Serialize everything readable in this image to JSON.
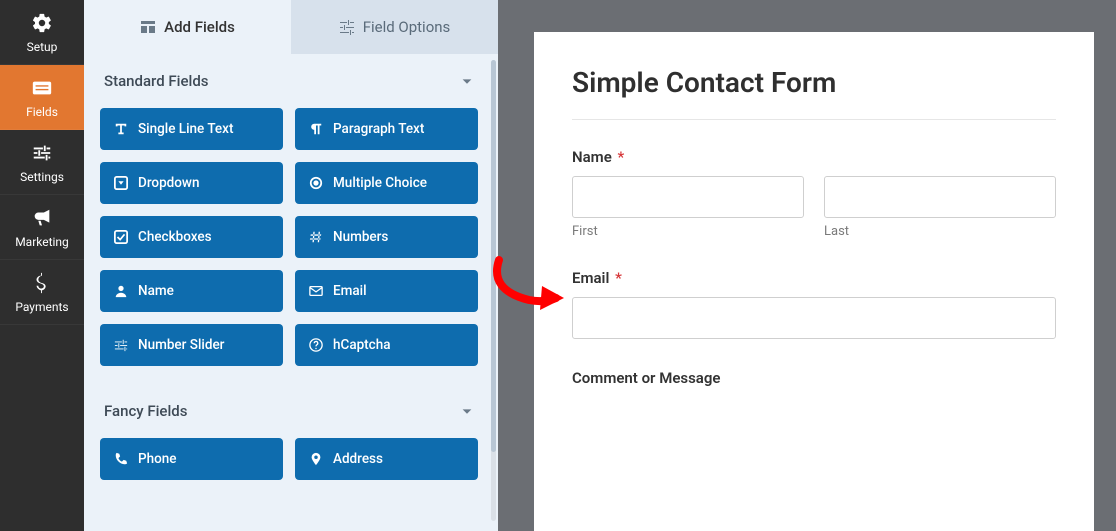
{
  "sidenav": {
    "items": [
      {
        "label": "Setup",
        "icon": "gear-icon"
      },
      {
        "label": "Fields",
        "icon": "form-icon"
      },
      {
        "label": "Settings",
        "icon": "sliders-icon"
      },
      {
        "label": "Marketing",
        "icon": "bullhorn-icon"
      },
      {
        "label": "Payments",
        "icon": "dollar-icon"
      }
    ],
    "active_index": 1
  },
  "panel": {
    "tabs": {
      "add_fields": "Add Fields",
      "field_options": "Field Options"
    },
    "groups": {
      "standard": {
        "title": "Standard Fields",
        "fields": [
          {
            "label": "Single Line Text",
            "icon": "text-icon"
          },
          {
            "label": "Paragraph Text",
            "icon": "paragraph-icon"
          },
          {
            "label": "Dropdown",
            "icon": "caret-square-icon"
          },
          {
            "label": "Multiple Choice",
            "icon": "radio-icon"
          },
          {
            "label": "Checkboxes",
            "icon": "check-square-icon"
          },
          {
            "label": "Numbers",
            "icon": "hash-icon"
          },
          {
            "label": "Name",
            "icon": "user-icon"
          },
          {
            "label": "Email",
            "icon": "envelope-icon"
          },
          {
            "label": "Number Slider",
            "icon": "sliders-icon"
          },
          {
            "label": "hCaptcha",
            "icon": "question-circle-icon"
          }
        ]
      },
      "fancy": {
        "title": "Fancy Fields",
        "fields": [
          {
            "label": "Phone",
            "icon": "phone-icon"
          },
          {
            "label": "Address",
            "icon": "map-pin-icon"
          }
        ]
      }
    }
  },
  "form": {
    "title": "Simple Contact Form",
    "name_label": "Name",
    "first_sub": "First",
    "last_sub": "Last",
    "email_label": "Email",
    "comment_label": "Comment or Message"
  },
  "annotation": {
    "color": "#ff0000"
  }
}
